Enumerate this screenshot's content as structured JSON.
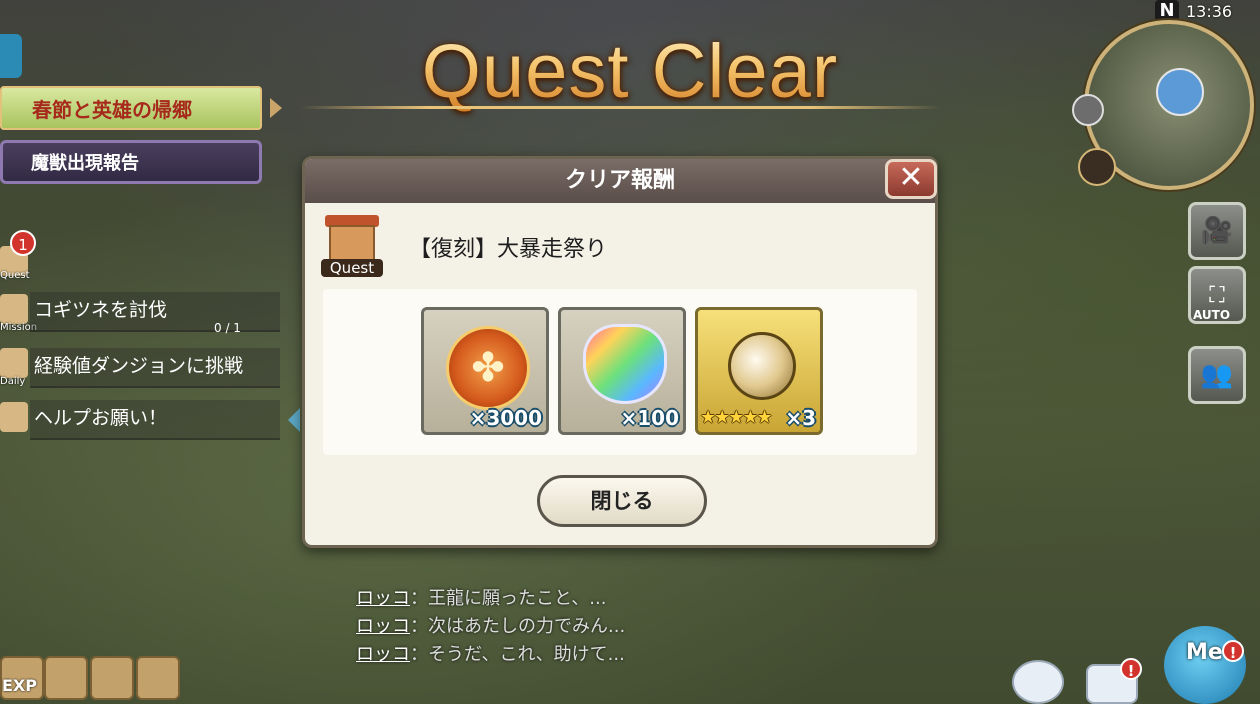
{
  "hud": {
    "clock": "13:36",
    "north": "N",
    "auto_label": "AUTO",
    "me_label": "Me",
    "exp_label": "EXP"
  },
  "title": "Quest Clear",
  "left_panel": {
    "event_banner": "春節と英雄の帰郷",
    "beast_report": "魔獣出現報告",
    "quest_badge": "1",
    "quest_label": "Quest",
    "missions": [
      {
        "icon_label": "Mission",
        "text": "コギツネを討伐",
        "progress": "0 / 1"
      },
      {
        "icon_label": "Daily",
        "text": "経験値ダンジョンに挑戦"
      },
      {
        "icon_label": "",
        "text": "ヘルプお願い！"
      }
    ]
  },
  "modal": {
    "header": "クリア報酬",
    "close_icon": "✕",
    "quest_icon_label": "Quest",
    "quest_name": "【復刻】大暴走祭り",
    "rewards": [
      {
        "name": "coin-medal",
        "count": "×3000",
        "stars": ""
      },
      {
        "name": "rainbow-crystal",
        "count": "×100",
        "stars": ""
      },
      {
        "name": "golden-orb-charm",
        "count": "×3",
        "stars": "★★★★★"
      }
    ],
    "close_button": "閉じる"
  },
  "chat": [
    {
      "speaker": "ロッコ",
      "sep": "：",
      "text": "王龍に願ったこと、..."
    },
    {
      "speaker": "ロッコ",
      "sep": "：",
      "text": "次はあたしの力でみん..."
    },
    {
      "speaker": "ロッコ",
      "sep": "：",
      "text": "そうだ、これ、助けて..."
    }
  ],
  "alerts": {
    "chat_alert": "!",
    "me_alert": "!"
  }
}
